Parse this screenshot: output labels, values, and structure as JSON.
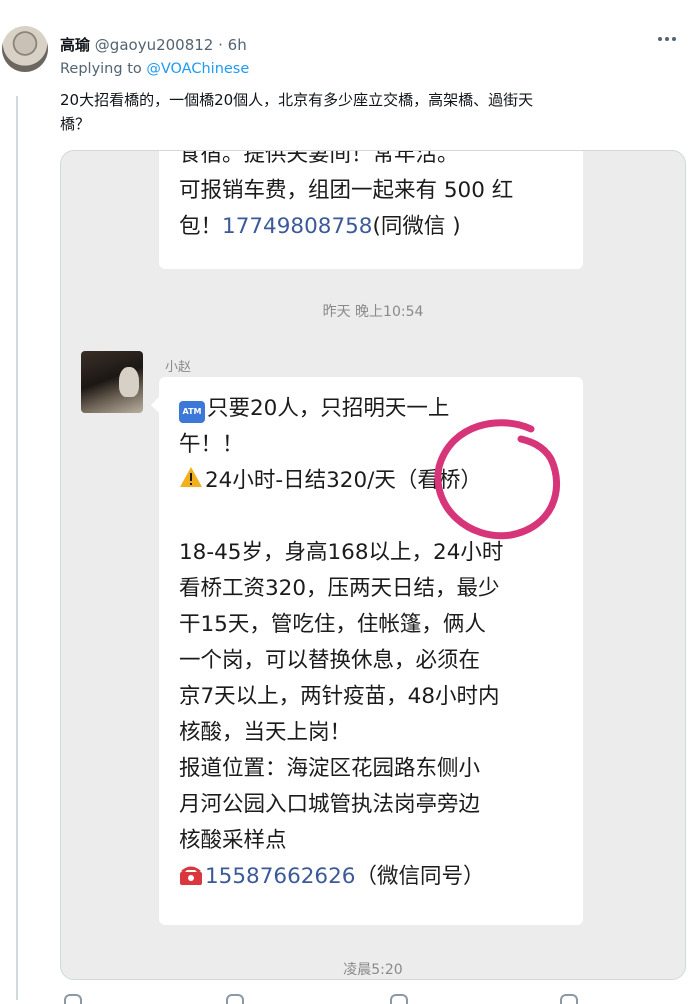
{
  "tweet": {
    "author_name": "高瑜",
    "handle": "@gaoyu200812",
    "separator": " · ",
    "time": "6h",
    "replying_to_prefix": "Replying to ",
    "replying_to_handle": "@VOAChinese",
    "text_line1": "20大招看橋的，一個橋20個人，北京有多少座立交橋，高架橋、過街天",
    "text_line2": "橋？"
  },
  "chat": {
    "message1": {
      "line1": "食宿。提供夫妻间！常年活。",
      "line2": "可报销车费，组团一起来有 500 红",
      "line3_prefix": "包！",
      "line3_phone": "17749808758",
      "line3_suffix": "(同微信 )"
    },
    "timestamp1": "昨天 晚上10:54",
    "sender": "小赵",
    "message2": {
      "atm_label": "ATM",
      "line1": "只要20人，只招明天一上",
      "line2": "午！！",
      "line3": "24小时-日结320/天（看桥）",
      "line4": "18-45岁，身高168以上，24小时",
      "line5": "看桥工资320，压两天日结，最少",
      "line6": "干15天，管吃住，住帐篷，俩人",
      "line7": "一个岗，可以替换休息，必须在",
      "line8": "京7天以上，两针疫苗，48小时内",
      "line9": "核酸，当天上岗！",
      "line10": "报道位置：海淀区花园路东侧小",
      "line11": "月河公园入口城管执法岗亭旁边",
      "line12": "核酸采样点",
      "phone": "15587662626",
      "phone_suffix": "（微信同号）"
    },
    "timestamp2": "凌晨5:20"
  },
  "colors": {
    "link": "#1d9bf0",
    "circle_annotation": "#d6357a",
    "chat_background": "#ececec"
  },
  "icons": [
    "more-icon",
    "atm-icon",
    "warning-icon",
    "telephone-icon"
  ]
}
